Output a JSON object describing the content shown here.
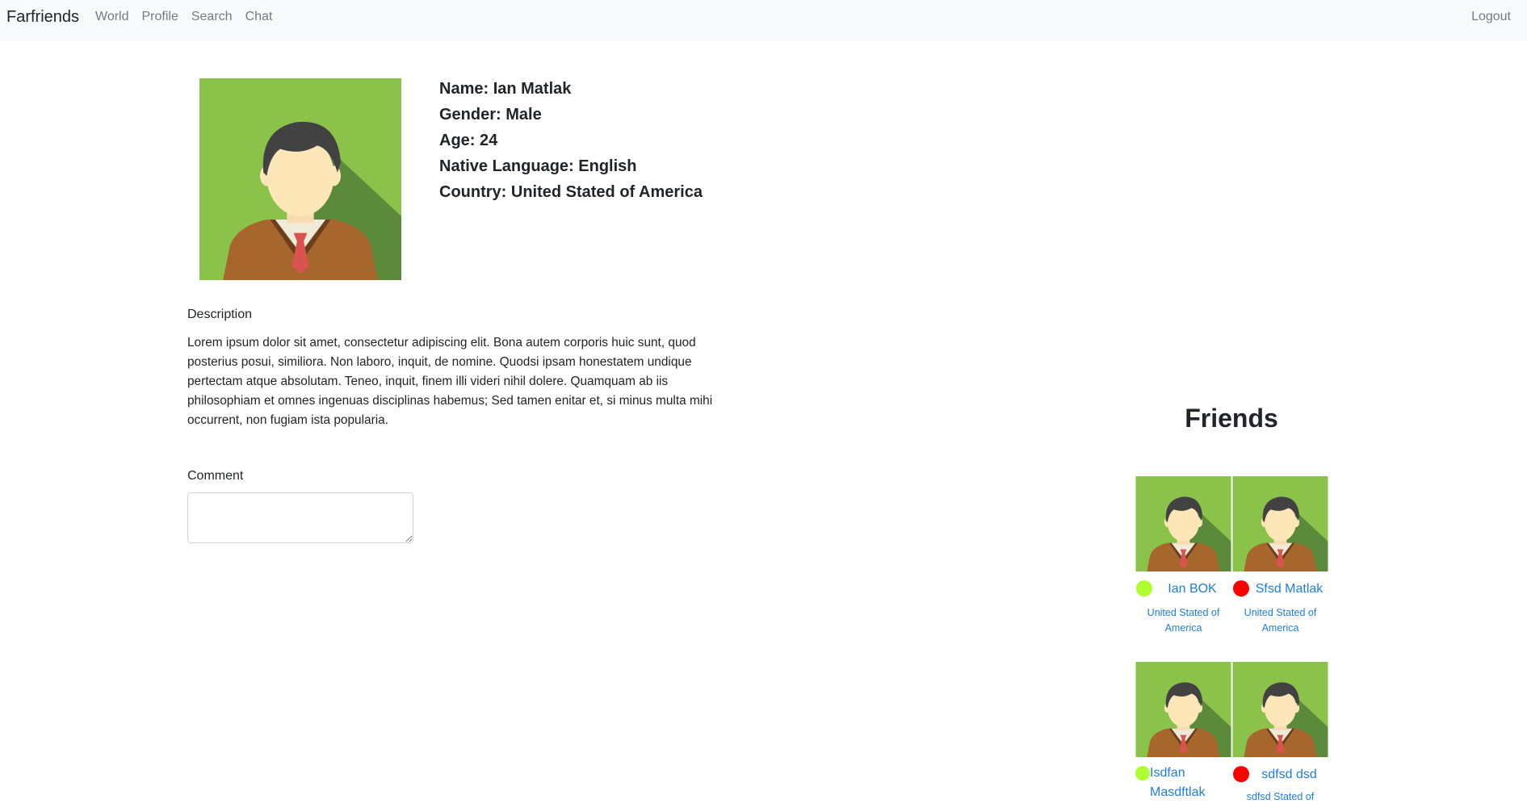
{
  "navbar": {
    "brand": "Farfriends",
    "links": [
      "World",
      "Profile",
      "Search",
      "Chat"
    ],
    "logout": "Logout"
  },
  "profile": {
    "name": "Name: Ian Matlak",
    "gender": "Gender: Male",
    "age": "Age: 24",
    "language": "Native Language: English",
    "country": "Country: United Stated of America"
  },
  "description": {
    "label": "Description",
    "text": "Lorem ipsum dolor sit amet, consectetur adipiscing elit. Bona autem corporis huic sunt, quod posterius posui, similiora. Non laboro, inquit, de nomine. Quodsi ipsam honestatem undique pertectam atque absolutam. Teneo, inquit, finem illi videri nihil dolere. Quamquam ab iis philosophiam et omnes ingenuas disciplinas habemus; Sed tamen enitar et, si minus multa mihi occurrent, non fugiam ista popularia."
  },
  "comment": {
    "label": "Comment",
    "value": ""
  },
  "friends": {
    "title": "Friends",
    "items": [
      {
        "name": "Ian BOK",
        "country": "United Stated of America",
        "status_color": "#adff2f"
      },
      {
        "name": "Sfsd Matlak",
        "country": "United Stated of America",
        "status_color": "#ff0000"
      },
      {
        "name": "Isdfan Masdftlak",
        "country": "",
        "status_color": "#adff2f"
      },
      {
        "name": "sdfsd dsd",
        "country": "sdfsd Stated of",
        "status_color": "#ff0000"
      }
    ]
  },
  "colors": {
    "link": "#1f7ed8",
    "navbar_bg": "#f8f9fa",
    "avatar_bg": "#8bc34a"
  },
  "icons": {
    "avatar": "male-avatar-illustration"
  }
}
